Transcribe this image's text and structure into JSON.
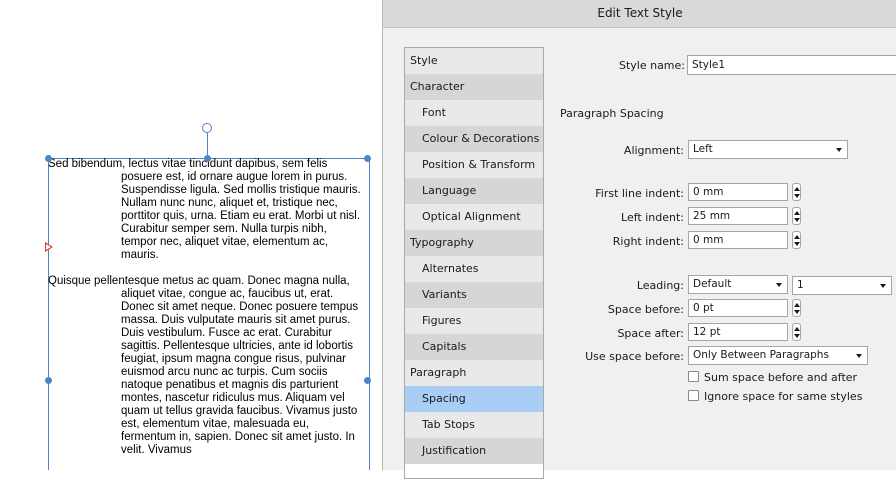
{
  "canvas": {
    "paragraphs": [
      "Sed bibendum, lectus vitae tincidunt dapibus, sem felis posuere est, id ornare augue lorem in purus. Suspendisse ligula. Sed mollis tristique mauris. Nullam nunc nunc, aliquet et, tristique nec, porttitor quis, urna. Etiam eu erat. Morbi ut nisl. Curabitur semper sem. Nulla turpis nibh, tempor nec, aliquet vitae, elementum ac, mauris.",
      "Quisque pellentesque metus ac quam. Donec magna nulla, aliquet vitae, congue ac, faucibus ut, erat. Donec sit amet neque. Donec posuere tempus massa. Duis vulputate mauris sit amet purus. Duis vestibulum. Fusce ac erat. Curabitur sagittis. Pellentesque ultricies, ante id lobortis feugiat, ipsum magna congue risus, pulvinar euismod arcu nunc ac turpis. Cum sociis natoque penatibus et magnis dis parturient montes, nascetur ridiculus mus. Aliquam vel quam ut tellus gravida faucibus. Vivamus justo est, elementum vitae, malesuada eu, fermentum in, sapien. Donec sit amet justo. In velit. Vivamus"
    ]
  },
  "dialog": {
    "title": "Edit Text Style",
    "nav": [
      {
        "label": "Style",
        "level": 0
      },
      {
        "label": "Character",
        "level": 0
      },
      {
        "label": "Font",
        "level": 1
      },
      {
        "label": "Colour & Decorations",
        "level": 1
      },
      {
        "label": "Position & Transform",
        "level": 1
      },
      {
        "label": "Language",
        "level": 1
      },
      {
        "label": "Optical Alignment",
        "level": 1
      },
      {
        "label": "Typography",
        "level": 0
      },
      {
        "label": "Alternates",
        "level": 1
      },
      {
        "label": "Variants",
        "level": 1
      },
      {
        "label": "Figures",
        "level": 1
      },
      {
        "label": "Capitals",
        "level": 1
      },
      {
        "label": "Paragraph",
        "level": 0
      },
      {
        "label": "Spacing",
        "level": 1,
        "selected": true
      },
      {
        "label": "Tab Stops",
        "level": 1
      },
      {
        "label": "Justification",
        "level": 1
      }
    ],
    "style_name_label": "Style name:",
    "style_name_value": "Style1",
    "section_heading": "Paragraph Spacing",
    "alignment_label": "Alignment:",
    "alignment_value": "Left",
    "first_indent_label": "First line indent:",
    "first_indent_value": "0 mm",
    "left_indent_label": "Left indent:",
    "left_indent_value": "25 mm",
    "right_indent_label": "Right indent:",
    "right_indent_value": "0 mm",
    "leading_label": "Leading:",
    "leading_value": "Default",
    "leading_multiplier": "1",
    "space_before_label": "Space before:",
    "space_before_value": "0 pt",
    "space_after_label": "Space after:",
    "space_after_value": "12 pt",
    "use_space_before_label": "Use space before:",
    "use_space_before_value": "Only Between Paragraphs",
    "sum_space_label": "Sum space before and after",
    "ignore_space_label": "Ignore space for same styles",
    "colors": {
      "selected": "#a9cdf5",
      "selection_frame": "#4a86c8",
      "baseline_marker": "#e0303a"
    }
  }
}
